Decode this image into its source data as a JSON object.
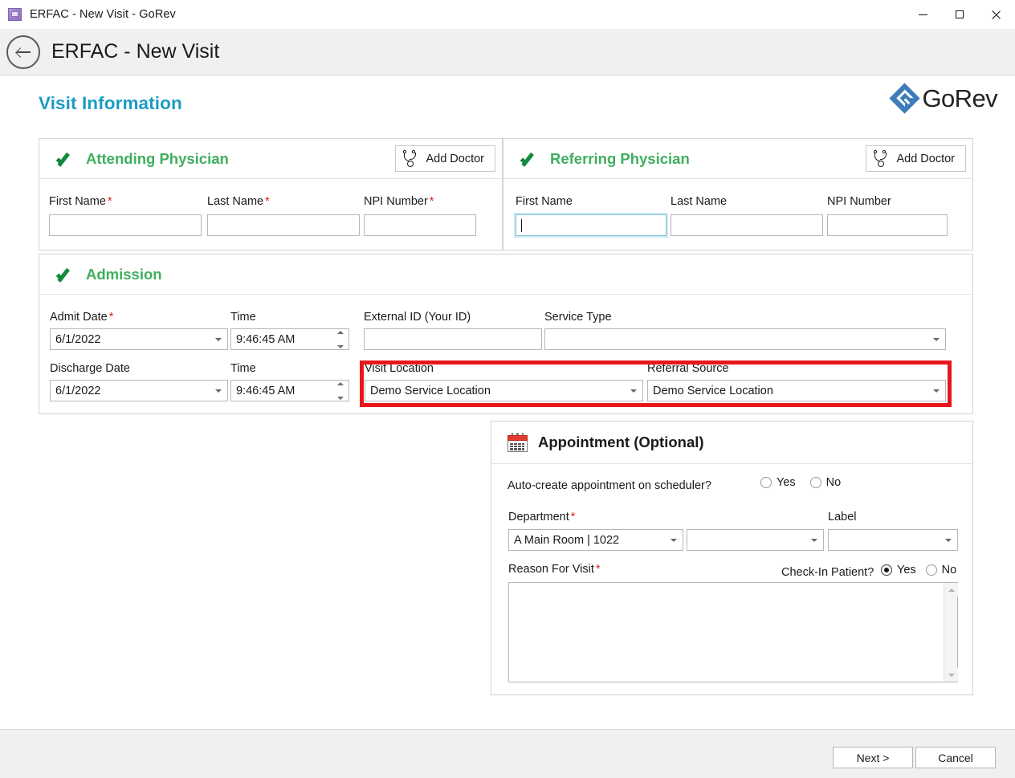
{
  "window": {
    "title": "ERFAC - New Visit - GoRev",
    "app_icon": "app-cube-icon",
    "minimize": "minimize-icon",
    "maximize": "maximize-icon",
    "close": "close-icon"
  },
  "header": {
    "back_icon": "back-arrow-icon",
    "title": "ERFAC - New Visit"
  },
  "page": {
    "heading": "Visit Information",
    "heading_color": "#1b9bc4",
    "logo_text": "GoRev",
    "logo_color": "#3d7cb8"
  },
  "attending": {
    "title": "Attending Physician",
    "title_color": "#3fae5f",
    "check_icon": "green-check-icon",
    "add_doctor": {
      "label": "Add Doctor",
      "icon": "stethoscope-icon"
    },
    "fields": [
      {
        "label": "First Name",
        "required": true,
        "value": ""
      },
      {
        "label": "Last Name",
        "required": true,
        "value": ""
      },
      {
        "label": "NPI Number",
        "required": true,
        "value": ""
      }
    ]
  },
  "referring": {
    "title": "Referring Physician",
    "title_color": "#3fae5f",
    "check_icon": "green-check-icon",
    "add_doctor": {
      "label": "Add Doctor",
      "icon": "stethoscope-icon"
    },
    "fields": [
      {
        "label": "First Name",
        "required": false,
        "value": "",
        "focused": true
      },
      {
        "label": "Last Name",
        "required": false,
        "value": ""
      },
      {
        "label": "NPI Number",
        "required": false,
        "value": ""
      }
    ]
  },
  "admission": {
    "title": "Admission",
    "title_color": "#3fae5f",
    "check_icon": "green-check-icon",
    "admit_date": {
      "label": "Admit Date",
      "required": true,
      "value": "6/1/2022"
    },
    "admit_time": {
      "label": "Time",
      "required": false,
      "value": "9:46:45 AM"
    },
    "external_id": {
      "label": "External ID (Your ID)",
      "required": false,
      "value": ""
    },
    "service_type": {
      "label": "Service Type",
      "required": false,
      "value": ""
    },
    "discharge_date": {
      "label": "Discharge Date",
      "required": false,
      "value": "6/1/2022"
    },
    "discharge_time": {
      "label": "Time",
      "required": false,
      "value": "9:46:45 AM"
    },
    "visit_location": {
      "label": "Visit Location",
      "required": false,
      "value": "Demo Service Location"
    },
    "referral_source": {
      "label": "Referral Source",
      "required": false,
      "value": "Demo Service Location"
    }
  },
  "highlight": {
    "color": "#e8161b",
    "note": "red-annotation-box-around-visit-location-and-referral-source"
  },
  "appointment": {
    "title": "Appointment (Optional)",
    "icon": "calendar-icon",
    "auto_create": {
      "label": "Auto-create appointment on scheduler?",
      "yes_label": "Yes",
      "no_label": "No",
      "selected": ""
    },
    "department": {
      "label": "Department",
      "required": true,
      "value": "A Main Room | 1022"
    },
    "department_secondary": {
      "label": "",
      "required": false,
      "value": ""
    },
    "label_field": {
      "label": "Label",
      "required": false,
      "value": ""
    },
    "reason": {
      "label": "Reason For Visit",
      "required": true,
      "value": ""
    },
    "check_in": {
      "label": "Check-In Patient?",
      "yes_label": "Yes",
      "no_label": "No",
      "selected": "Yes"
    }
  },
  "footer": {
    "next_label": "Next >",
    "cancel_label": "Cancel"
  }
}
